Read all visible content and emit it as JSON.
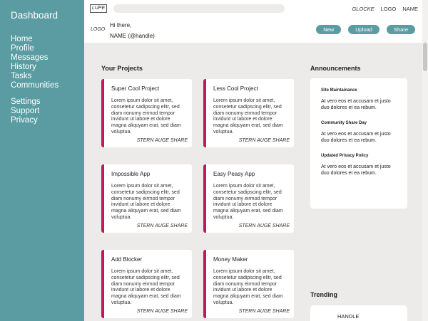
{
  "sidebar": {
    "dashboard": "Dashboard",
    "nav": [
      "Home",
      "Profile",
      "Messages",
      "History",
      "Tasks",
      "Communities"
    ],
    "nav2": [
      "Settings",
      "Support",
      "Privacy"
    ]
  },
  "header": {
    "lupe": "LUPE",
    "glocke": "GLOCKE",
    "logo": "LOGO",
    "name": "NAME",
    "logo_left": "LOGO",
    "greeting": "Hi there,",
    "handle": "NAME (@handle)",
    "buttons": [
      "New",
      "Upload",
      "Share"
    ]
  },
  "projects": {
    "title": "Your Projects",
    "share_label": "STERN AUGE SHARE",
    "items": [
      {
        "title": "Super Cool Project",
        "body": "Lorem ipsum dolor sit amet, consetetur sadipscing elitr, sed diam nonumy eirmod tempor invidunt ut labore et dolore magna aliquyam erat, sed diam voluptua."
      },
      {
        "title": "Less Cool Project",
        "body": "Lorem ipsum dolor sit amet, consetetur sadipscing elitr, sed diam nonumy eirmod tempor invidunt ut labore et dolore magna aliquyam erat, sed diam voluptua."
      },
      {
        "title": "Impossible App",
        "body": "Lorem ipsum dolor sit amet, consetetur sadipscing elitr, sed diam nonumy eirmod tempor invidunt ut labore et dolore magna aliquyam erat, sed diam voluptua."
      },
      {
        "title": "Easy Peasy App",
        "body": "Lorem ipsum dolor sit amet, consetetur sadipscing elitr, sed diam nonumy eirmod tempor invidunt ut labore et dolore magna aliquyam erat, sed diam voluptua."
      },
      {
        "title": "Add Blocker",
        "body": "Lorem ipsum dolor sit amet, consetetur sadipscing elitr, sed diam nonumy eirmod tempor invidunt ut labore et dolore magna aliquyam erat, sed diam voluptua."
      },
      {
        "title": "Money Maker",
        "body": "Lorem ipsum dolor sit amet, consetetur sadipscing elitr, sed diam nonumy eirmod tempor invidunt ut labore et dolore magna aliquyam erat, sed diam voluptua."
      }
    ]
  },
  "announcements": {
    "title": "Announcements",
    "items": [
      {
        "title": "Site Maintainance",
        "body": "At vero eos et accusam et justo duo dolores et ea rebum."
      },
      {
        "title": "Community Share Day",
        "body": "At vero eos et accusam et justo duo dolores et ea rebum."
      },
      {
        "title": "Updated Privacy Policy",
        "body": "At vero eos et accusam et justo duo dolores et ea rebum."
      }
    ]
  },
  "trending": {
    "title": "Trending",
    "handle": "HANDLE"
  }
}
